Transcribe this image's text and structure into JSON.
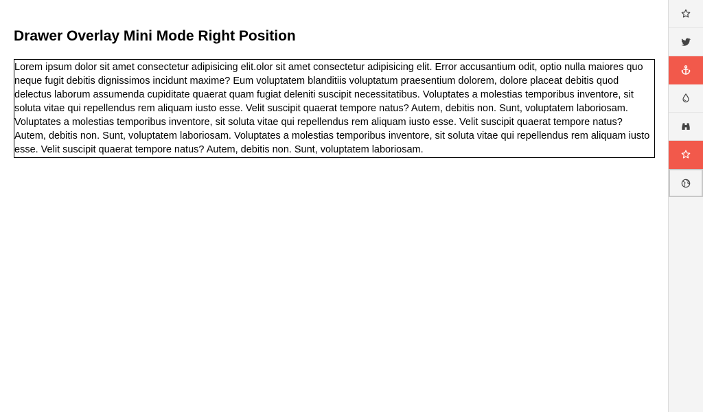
{
  "page": {
    "title": "Drawer Overlay Mini Mode Right Position",
    "paragraph": "Lorem ipsum dolor sit amet consectetur adipisicing elit.olor sit amet consectetur adipisicing elit. Error accusantium odit, optio nulla maiores quo neque fugit debitis dignissimos incidunt maxime? Eum voluptatem blanditiis voluptatum praesentium dolorem, dolore placeat debitis quod delectus laborum assumenda cupiditate quaerat quam fugiat deleniti suscipit necessitatibus. Voluptates a molestias temporibus inventore, sit soluta vitae qui repellendus rem aliquam iusto esse. Velit suscipit quaerat tempore natus? Autem, debitis non. Sunt, voluptatem laboriosam. Voluptates a molestias temporibus inventore, sit soluta vitae qui repellendus rem aliquam iusto esse. Velit suscipit quaerat tempore natus? Autem, debitis non. Sunt, voluptatem laboriosam. Voluptates a molestias temporibus inventore, sit soluta vitae qui repellendus rem aliquam iusto esse. Velit suscipit quaerat tempore natus? Autem, debitis non. Sunt, voluptatem laboriosam."
  },
  "drawer": {
    "position": "right",
    "mode": "mini",
    "accent_color": "#f2594b",
    "items": [
      {
        "icon": "star-outline-icon",
        "state": "normal"
      },
      {
        "icon": "twitter-icon",
        "state": "normal"
      },
      {
        "icon": "anchor-icon",
        "state": "active"
      },
      {
        "icon": "drop-icon",
        "state": "normal"
      },
      {
        "icon": "binoculars-icon",
        "state": "normal"
      },
      {
        "icon": "star-outline-icon",
        "state": "active"
      },
      {
        "icon": "globe-icon",
        "state": "focused"
      }
    ]
  }
}
